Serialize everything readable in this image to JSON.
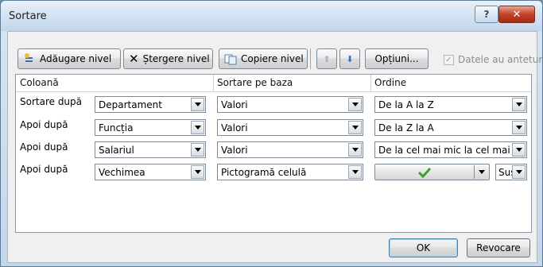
{
  "window": {
    "title": "Sortare"
  },
  "toolbar": {
    "add_level": "Adăugare nivel",
    "delete_level": "Ștergere nivel",
    "copy_level": "Copiere nivel",
    "options": "Opțiuni...",
    "headers_checkbox": "Datele au anteturi",
    "headers_checked": true
  },
  "grid": {
    "headers": [
      "Coloană",
      "Sortare pe baza",
      "Ordine"
    ],
    "rows": [
      {
        "label": "Sortare după",
        "column": "Departament",
        "sort_on": "Valori",
        "order": "De la A la Z"
      },
      {
        "label": "Apoi după",
        "column": "Funcția",
        "sort_on": "Valori",
        "order": "De la Z la A"
      },
      {
        "label": "Apoi după",
        "column": "Salariul",
        "sort_on": "Valori",
        "order": "De la cel mai mic la cel mai mare"
      },
      {
        "label": "Apoi după",
        "column": "Vechimea",
        "sort_on": "Pictogramă celulă",
        "order_icon": "green-checkmark-icon",
        "order_position": "Sus"
      }
    ]
  },
  "footer": {
    "ok": "OK",
    "cancel": "Revocare"
  },
  "colors": {
    "accent": "#3c7fb1",
    "close_red": "#c4412a",
    "check_green": "#3aa32a"
  }
}
